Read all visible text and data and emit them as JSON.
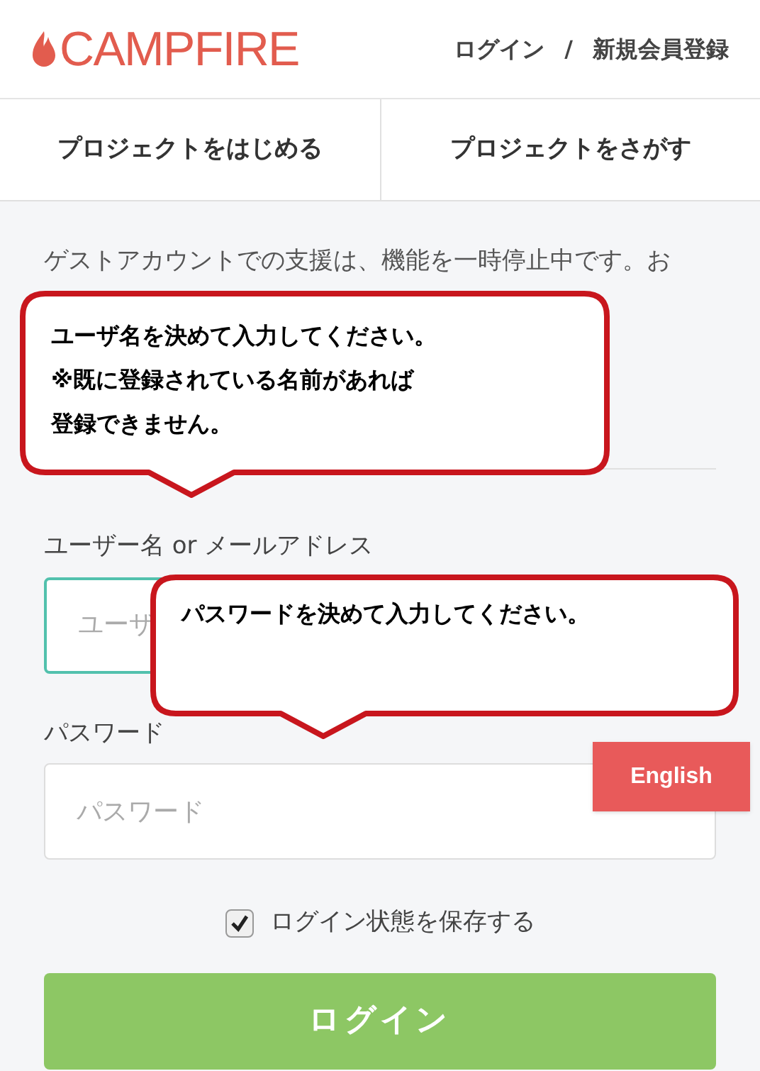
{
  "header": {
    "logo": "CAMPFIRE",
    "links": [
      "ログイン",
      "/",
      "新規会員登録"
    ]
  },
  "nav": {
    "tabs": [
      {
        "label": "プロジェクトをはじめる",
        "selected": false
      },
      {
        "label": "プロジェクトをさがす",
        "selected": false
      }
    ]
  },
  "notice": "ゲストアカウントでの支援は、機能を一時停止中です。お",
  "form": {
    "username_label": "ユーザー名 or メールアドレス",
    "username_placeholder": "ユーザ",
    "password_label": "パスワード",
    "password_placeholder": "パスワード",
    "remember": {
      "label": "ログイン状態を保存する",
      "checked": true
    },
    "submit": "ログイン"
  },
  "language_button": "English",
  "callouts": [
    {
      "lines": [
        "ユーザ名を決めて入力してください。",
        "※既に登録されている名前があれば",
        "登録できません。"
      ]
    },
    {
      "lines": [
        "パスワードを決めて入力してください。"
      ]
    }
  ]
}
